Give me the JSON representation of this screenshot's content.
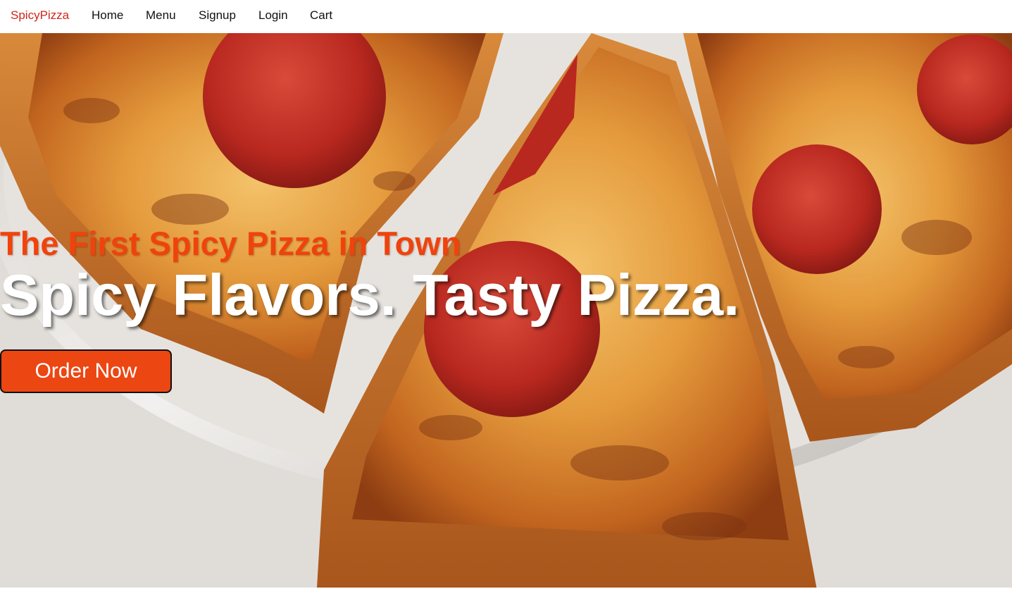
{
  "navbar": {
    "brand": "SpicyPizza",
    "links": [
      "Home",
      "Menu",
      "Signup",
      "Login",
      "Cart"
    ]
  },
  "hero": {
    "tagline": "The First Spicy Pizza in Town",
    "headline": "Spicy Flavors. Tasty Pizza.",
    "cta_label": "Order Now",
    "background_image": "pepperoni-pizza-slices-photo"
  },
  "colors": {
    "brand": "#d0261b",
    "accent": "#ec4612",
    "tagline": "#f0430c",
    "headline": "#ffffff"
  }
}
